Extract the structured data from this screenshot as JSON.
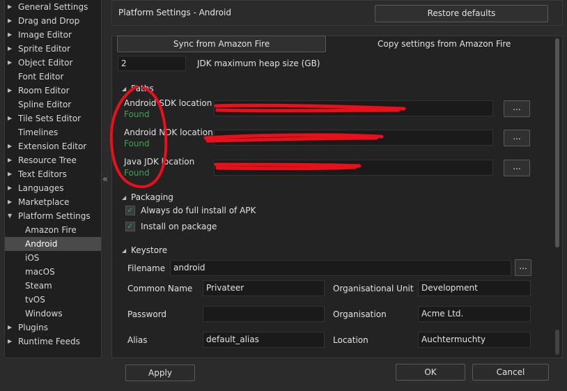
{
  "sidebar": {
    "items": [
      {
        "label": "General Settings",
        "expandable": true,
        "child": false,
        "selected": false
      },
      {
        "label": "Drag and Drop",
        "expandable": true,
        "child": false,
        "selected": false
      },
      {
        "label": "Image Editor",
        "expandable": true,
        "child": false,
        "selected": false
      },
      {
        "label": "Sprite Editor",
        "expandable": true,
        "child": false,
        "selected": false
      },
      {
        "label": "Object Editor",
        "expandable": true,
        "child": false,
        "selected": false
      },
      {
        "label": "Font Editor",
        "expandable": false,
        "child": false,
        "selected": false
      },
      {
        "label": "Room Editor",
        "expandable": true,
        "child": false,
        "selected": false
      },
      {
        "label": "Spline Editor",
        "expandable": false,
        "child": false,
        "selected": false
      },
      {
        "label": "Tile Sets Editor",
        "expandable": true,
        "child": false,
        "selected": false
      },
      {
        "label": "Timelines",
        "expandable": false,
        "child": false,
        "selected": false
      },
      {
        "label": "Extension Editor",
        "expandable": true,
        "child": false,
        "selected": false
      },
      {
        "label": "Resource Tree",
        "expandable": true,
        "child": false,
        "selected": false
      },
      {
        "label": "Text Editors",
        "expandable": true,
        "child": false,
        "selected": false
      },
      {
        "label": "Languages",
        "expandable": true,
        "child": false,
        "selected": false
      },
      {
        "label": "Marketplace",
        "expandable": true,
        "child": false,
        "selected": false
      },
      {
        "label": "Platform Settings",
        "expandable": true,
        "expanded": true,
        "child": false,
        "selected": false
      },
      {
        "label": "Amazon Fire",
        "expandable": false,
        "child": true,
        "selected": false
      },
      {
        "label": "Android",
        "expandable": false,
        "child": true,
        "selected": true
      },
      {
        "label": "iOS",
        "expandable": false,
        "child": true,
        "selected": false
      },
      {
        "label": "macOS",
        "expandable": false,
        "child": true,
        "selected": false
      },
      {
        "label": "Steam",
        "expandable": false,
        "child": true,
        "selected": false
      },
      {
        "label": "tvOS",
        "expandable": false,
        "child": true,
        "selected": false
      },
      {
        "label": "Windows",
        "expandable": false,
        "child": true,
        "selected": false
      },
      {
        "label": "Plugins",
        "expandable": true,
        "child": false,
        "selected": false
      },
      {
        "label": "Runtime Feeds",
        "expandable": true,
        "child": false,
        "selected": false
      }
    ],
    "collapse_glyph": "«"
  },
  "header": {
    "title": "Platform Settings - Android",
    "restore_label": "Restore defaults"
  },
  "top": {
    "sync_label": "Sync from Amazon Fire",
    "copy_label": "Copy settings from Amazon Fire",
    "heap_value": "2",
    "heap_label": "JDK maximum heap size (GB)"
  },
  "paths": {
    "title": "Paths",
    "sdk_label": "Android SDK location",
    "sdk_status": "Found",
    "ndk_label": "Android NDK location",
    "ndk_status": "Found",
    "jdk_label": "Java JDK location",
    "jdk_status": "Found",
    "browse_label": "..."
  },
  "packaging": {
    "title": "Packaging",
    "full_install_label": "Always do full install of APK",
    "full_install_checked": true,
    "install_on_package_label": "Install on package",
    "install_on_package_checked": true
  },
  "keystore": {
    "title": "Keystore",
    "filename_label": "Filename",
    "filename_value": "android",
    "browse_label": "...",
    "common_name_label": "Common Name",
    "common_name_value": "Privateer",
    "org_unit_label": "Organisational Unit",
    "org_unit_value": "Development",
    "password_label": "Password",
    "password_value": "",
    "organisation_label": "Organisation",
    "organisation_value": "Acme Ltd.",
    "alias_label": "Alias",
    "alias_value": "default_alias",
    "location_label": "Location",
    "location_value": "Auchtermuchty"
  },
  "footer": {
    "apply_label": "Apply",
    "ok_label": "OK",
    "cancel_label": "Cancel"
  },
  "colors": {
    "found": "#3fa34d",
    "annotation_red": "#e8101a",
    "selected_row": "#4a4a4a",
    "check": "#2bb24c"
  }
}
